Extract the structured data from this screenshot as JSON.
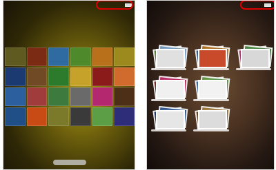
{
  "left_screen": {
    "status": {
      "left": "",
      "right": ""
    },
    "thumbnails": [
      {
        "color": "#5f5a20"
      },
      {
        "color": "#7b2b14"
      },
      {
        "color": "#2f6aa0"
      },
      {
        "color": "#4e8a2b"
      },
      {
        "color": "#b8711a"
      },
      {
        "color": "#9c8a1f"
      },
      {
        "color": "#1b3a72"
      },
      {
        "color": "#6f4a24"
      },
      {
        "color": "#2c7a2c"
      },
      {
        "color": "#c7a22a"
      },
      {
        "color": "#8b1a1a"
      },
      {
        "color": "#d06b2d"
      },
      {
        "color": "#2b5f9e"
      },
      {
        "color": "#a13c3c"
      },
      {
        "color": "#3d7a3d"
      },
      {
        "color": "#6a6a6a"
      },
      {
        "color": "#b3286f"
      },
      {
        "color": "#4d2f17"
      },
      {
        "color": "#1f4f86"
      },
      {
        "color": "#c84a14"
      },
      {
        "color": "#7a7a2a"
      },
      {
        "color": "#3a3a3a"
      },
      {
        "color": "#5c9e45"
      },
      {
        "color": "#2d2d7a"
      }
    ],
    "highlight_color": "#e00000"
  },
  "right_screen": {
    "status": {
      "left": "",
      "right": ""
    },
    "stacks": [
      {
        "colors": [
          "#5e8a3c",
          "#7aa2c9",
          "#e0e0e0"
        ]
      },
      {
        "colors": [
          "#2e5e9a",
          "#b7771f",
          "#c94a2a"
        ]
      },
      {
        "colors": [
          "#b23c7a",
          "#4d8f45",
          "#d8d8d8"
        ]
      },
      {
        "colors": [
          "#7a2a2a",
          "#c02b6a",
          "#f0f0f0"
        ]
      },
      {
        "colors": [
          "#3a6fb0",
          "#5f9c44",
          "#f2f2f2"
        ]
      },
      {
        "colors": []
      },
      {
        "colors": [
          "#1c3f78",
          "#335c9a",
          "#e6e6e6"
        ]
      },
      {
        "colors": [
          "#6b4b2b",
          "#a17a3b",
          "#dcdcdc"
        ]
      },
      {
        "colors": []
      }
    ],
    "highlight_color": "#e00000"
  }
}
